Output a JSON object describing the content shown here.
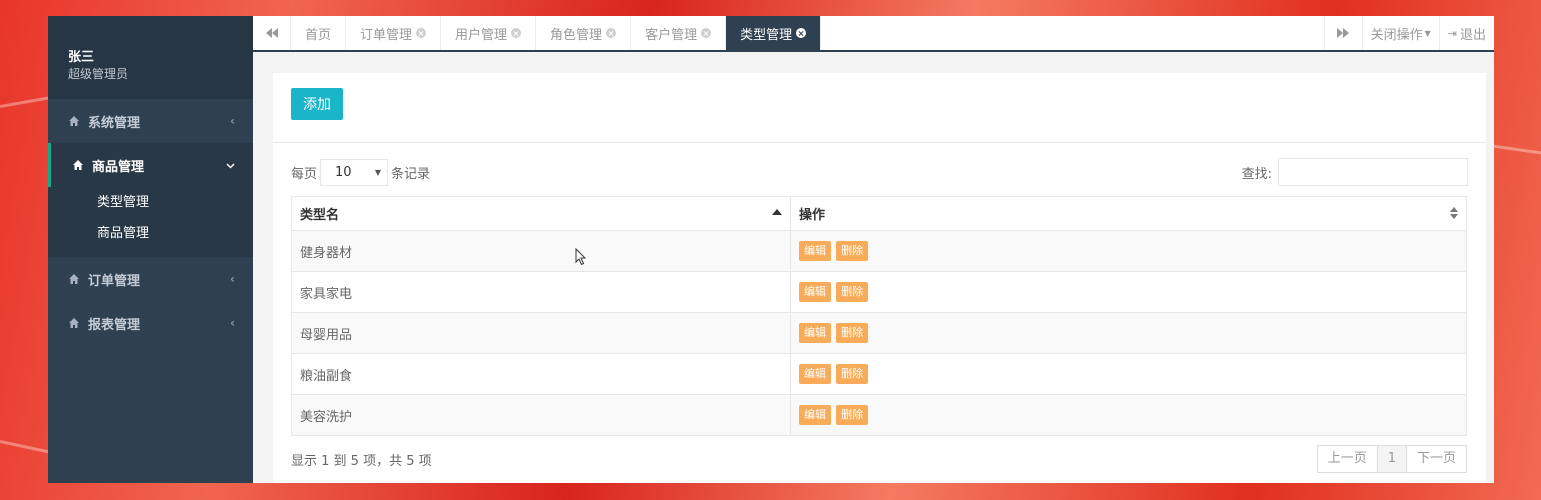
{
  "user": {
    "name": "张三",
    "role": "超级管理员"
  },
  "sidebar": {
    "items": [
      {
        "label": "系统管理"
      },
      {
        "label": "商品管理",
        "sub": [
          "类型管理",
          "商品管理"
        ]
      },
      {
        "label": "订单管理"
      },
      {
        "label": "报表管理"
      }
    ]
  },
  "tabs": [
    {
      "label": "首页"
    },
    {
      "label": "订单管理"
    },
    {
      "label": "用户管理"
    },
    {
      "label": "角色管理"
    },
    {
      "label": "客户管理"
    },
    {
      "label": "类型管理"
    }
  ],
  "tools": {
    "close_ops": "关闭操作",
    "logout": "退出"
  },
  "toolbar": {
    "add_label": "添加"
  },
  "table_ctrl": {
    "per_page_prefix": "每页",
    "per_page_value": "10",
    "per_page_suffix": "条记录",
    "search_label": "查找:",
    "search_value": ""
  },
  "table": {
    "headers": [
      "类型名",
      "操作"
    ],
    "rows": [
      {
        "name": "健身器材",
        "edit": "编辑",
        "delete": "删除"
      },
      {
        "name": "家具家电",
        "edit": "编辑",
        "delete": "删除"
      },
      {
        "name": "母婴用品",
        "edit": "编辑",
        "delete": "删除"
      },
      {
        "name": "粮油副食",
        "edit": "编辑",
        "delete": "删除"
      },
      {
        "name": "美容洗护",
        "edit": "编辑",
        "delete": "删除"
      }
    ]
  },
  "footer": {
    "info": "显示 1 到 5 项，共 5 项",
    "prev": "上一页",
    "page": "1",
    "next": "下一页"
  },
  "colors": {
    "sidebar": "#2f4050",
    "accent": "#1ab5c9",
    "warning": "#f8ac59"
  }
}
